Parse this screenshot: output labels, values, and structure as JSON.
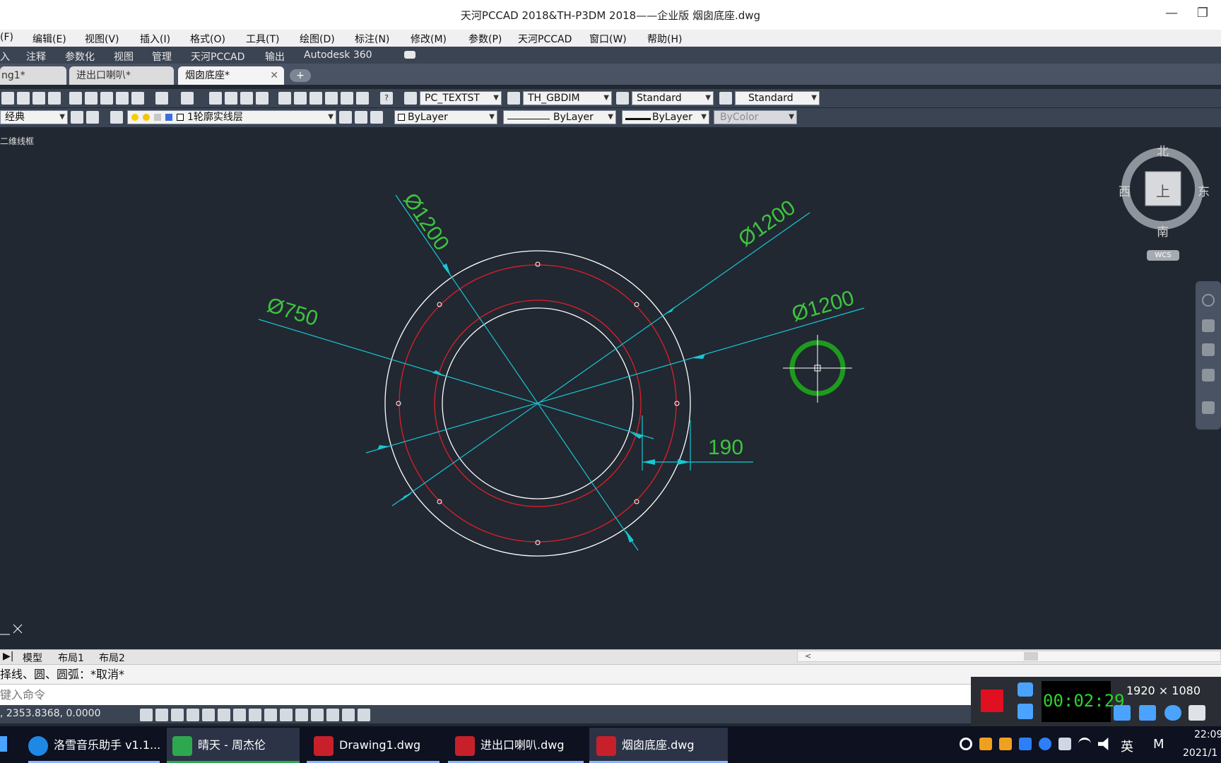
{
  "window": {
    "title": "天河PCCAD 2018&TH-P3DM 2018——企业版      烟囱底座.dwg",
    "min_glyph": "—",
    "max_glyph": "❐"
  },
  "menu": [
    "(F)",
    "编辑(E)",
    "视图(V)",
    "插入(I)",
    "格式(O)",
    "工具(T)",
    "绘图(D)",
    "标注(N)",
    "修改(M)",
    "参数(P)",
    "天河PCCAD",
    "窗口(W)",
    "帮助(H)"
  ],
  "ribbon": [
    "入",
    "注释",
    "参数化",
    "视图",
    "管理",
    "天河PCCAD",
    "输出",
    "Autodesk 360"
  ],
  "tabs": [
    {
      "label": "ng1*"
    },
    {
      "label": "进出口喇叭*"
    },
    {
      "label": "烟囱底座*",
      "active": true
    }
  ],
  "tab_close": "✕",
  "tab_add": "+",
  "toolbar1": {
    "text_style": "PC_TEXTST",
    "dim_style": "TH_GBDIM",
    "table_style": "Standard",
    "ml_style": "Standard"
  },
  "toolbar2": {
    "workspace": "经典",
    "layer": "1轮廓实线层",
    "color": "ByLayer",
    "linetype": "ByLayer",
    "lineweight": "ByLayer",
    "plotstyle": "ByColor"
  },
  "viewport": {
    "label": "二维线框",
    "dims": {
      "d1": "Ø1200",
      "d2": "Ø1200",
      "d3": "Ø1200",
      "d4": "Ø750",
      "d5": "190"
    }
  },
  "viewcube": {
    "north": "北",
    "south": "南",
    "east": "东",
    "west": "西",
    "top": "上",
    "wcs": "WCS"
  },
  "layout_tabs": [
    "模型",
    "布局1",
    "布局2"
  ],
  "command": {
    "history": "择线、圆、圆弧：*取消*",
    "prompt": "键入命令"
  },
  "status": {
    "coords": ", 2353.8368, 0.0000"
  },
  "recorder": {
    "time": "00:02:29",
    "resolution": "1920 × 1080"
  },
  "taskbar": {
    "items": [
      "洛雪音乐助手 v1.1...",
      "晴天 - 周杰伦",
      "Drawing1.dwg",
      "进出口喇叭.dwg",
      "烟囱底座.dwg"
    ],
    "ime": "英",
    "ime2": "M",
    "clock_time": "22:09",
    "clock_date": "2021/1"
  },
  "colors": {
    "canvas": "#212831",
    "dim": "#19c6d4",
    "dimtext": "#3ec43e",
    "outline": "#ffffff",
    "redline": "#e01e2a",
    "cursor": "#1e9a1e"
  }
}
